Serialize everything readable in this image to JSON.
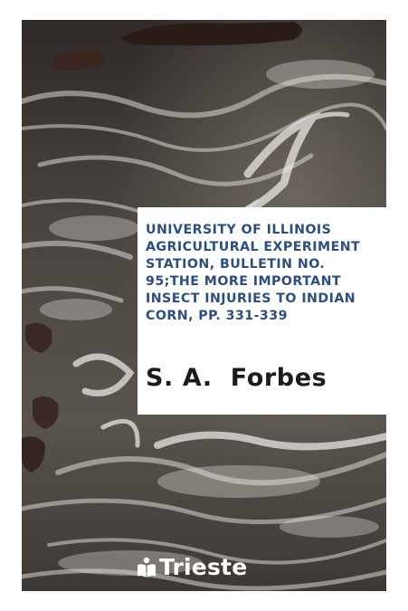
{
  "cover": {
    "title": "UNIVERSITY OF ILLINOIS\nAGRICULTURAL EXPERIMENT\nSTATION, BULLETIN NO.\n95;THE MORE IMPORTANT\nINSECT INJURIES TO INDIAN\nCORN, PP. 331-339",
    "author": "S. A.  Forbes",
    "publisher": "Trieste",
    "publisher_icon": "open-book-logo-icon",
    "title_color": "#2e4f79",
    "author_color": "#1c1c1c",
    "background_image": "ocean-waves-and-rocks-photo"
  }
}
